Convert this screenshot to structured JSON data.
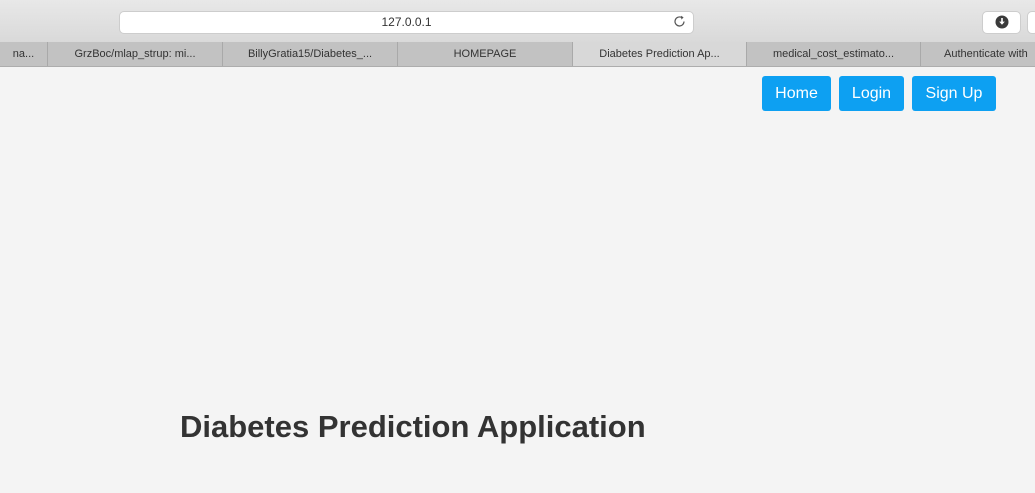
{
  "browser": {
    "address": "127.0.0.1",
    "tabs": [
      {
        "label": "na..."
      },
      {
        "label": "GrzBoc/mlap_strup: mi..."
      },
      {
        "label": "BillyGratia15/Diabetes_..."
      },
      {
        "label": "HOMEPAGE"
      },
      {
        "label": "Diabetes Prediction Ap...",
        "active": true
      },
      {
        "label": "medical_cost_estimato..."
      },
      {
        "label": "Authenticate with"
      }
    ],
    "icons": {
      "reload": "reload-icon",
      "download": "download-icon"
    }
  },
  "nav": {
    "home": "Home",
    "login": "Login",
    "signup": "Sign Up",
    "button_color": "#0da0f2"
  },
  "main": {
    "title": "Diabetes Prediction Application"
  }
}
